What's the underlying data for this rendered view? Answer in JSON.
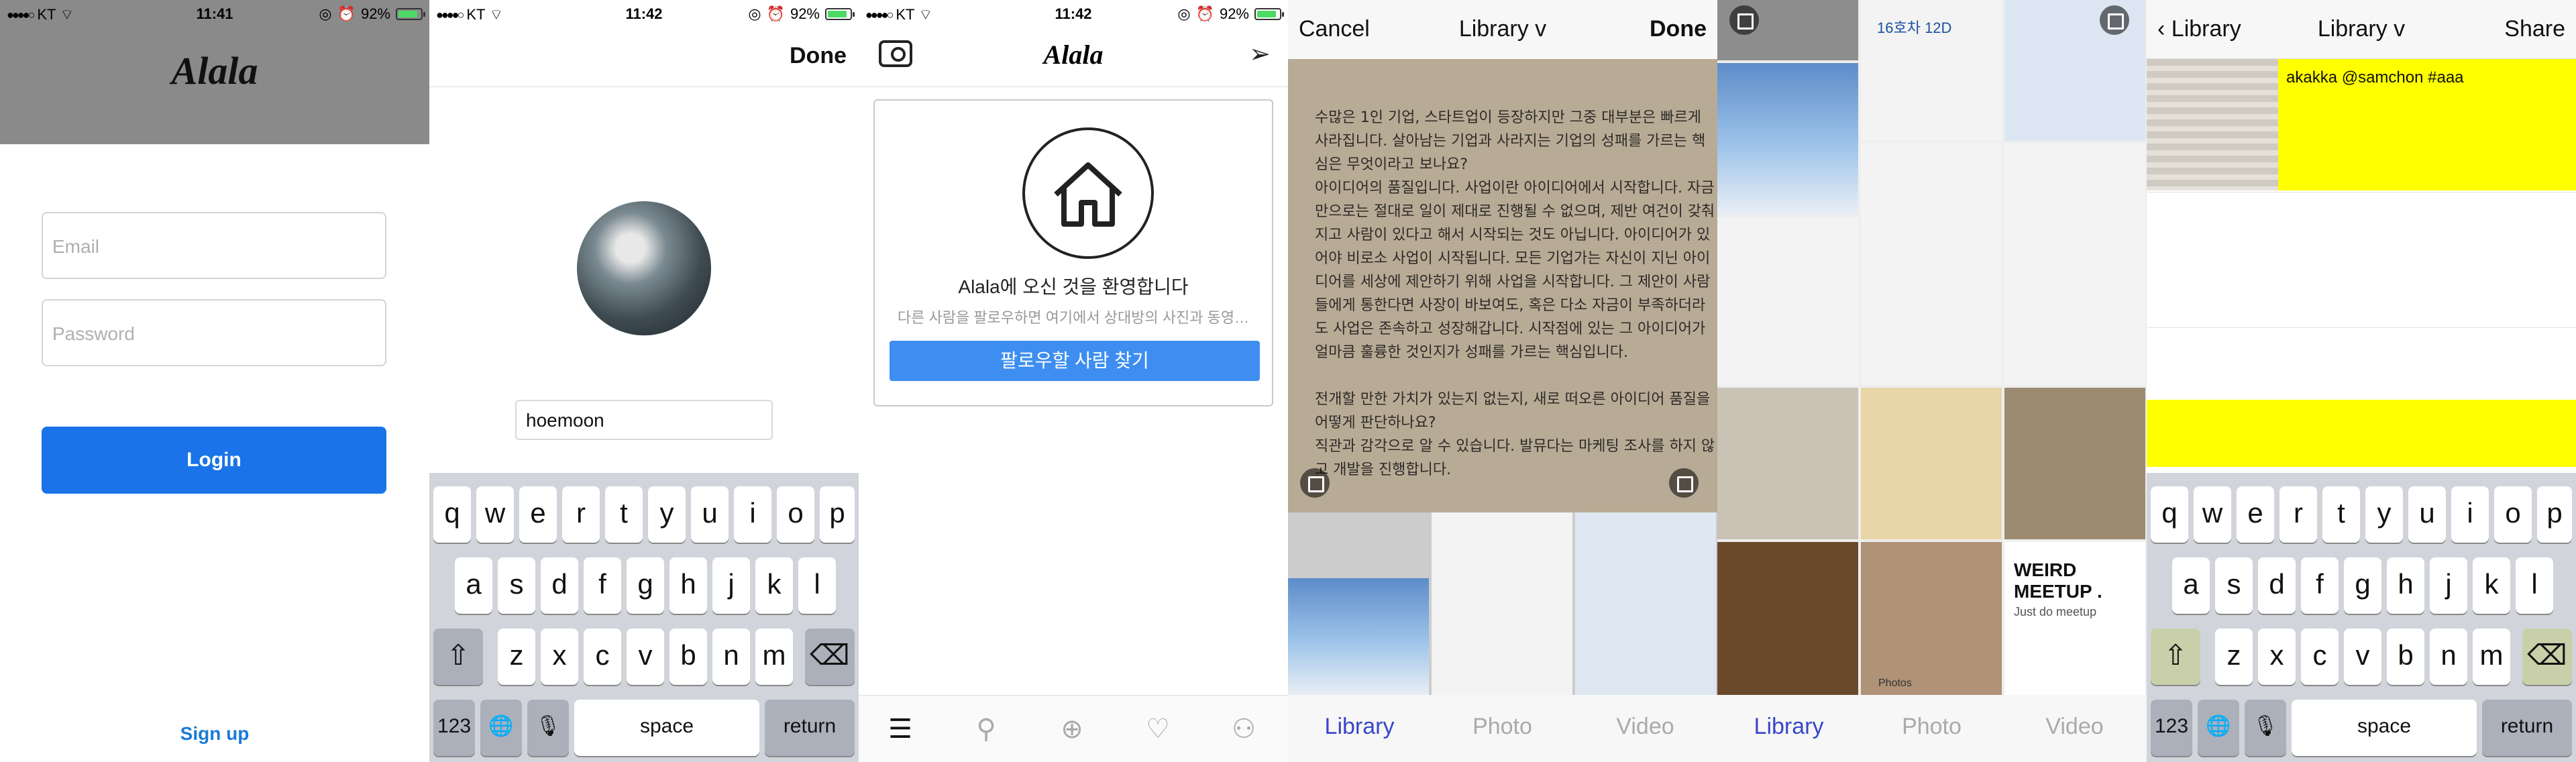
{
  "status": {
    "left_carrier": "KT",
    "battery": "92%",
    "times": [
      "11:41",
      "11:42",
      "11:42"
    ]
  },
  "login": {
    "logo": "Alala",
    "email_placeholder": "Email",
    "password_placeholder": "Password",
    "login_label": "Login",
    "signup_label": "Sign up"
  },
  "profile": {
    "done_label": "Done",
    "username_value": "hoemoon"
  },
  "keyboard": {
    "row1": [
      "q",
      "w",
      "e",
      "r",
      "t",
      "y",
      "u",
      "i",
      "o",
      "p"
    ],
    "row2": [
      "a",
      "s",
      "d",
      "f",
      "g",
      "h",
      "j",
      "k",
      "l"
    ],
    "row3": [
      "z",
      "x",
      "c",
      "v",
      "b",
      "n",
      "m"
    ],
    "num_label": "123",
    "space_label": "space",
    "return_label": "return"
  },
  "feed": {
    "logo": "Alala",
    "welcome": "Alala에 오신 것을 환영합니다",
    "sub": "다른 사람을 팔로우하면 여기에서 상대방의 사진과 동영…",
    "find_button": "팔로우할 사람 찾기"
  },
  "picker": {
    "cancel_label": "Cancel",
    "title": "Library v",
    "done_label": "Done",
    "doc_text": "수많은 1인 기업, 스타트업이 등장하지만 그중 대부분은 빠르게 사라집니다. 살아남는 기업과 사라지는 기업의 성패를 가르는 핵심은 무엇이라고 보나요?\n아이디어의 품질입니다. 사업이란 아이디어에서 시작합니다. 자금만으로는 절대로 일이 제대로 진행될 수 없으며, 제반 여건이 갖춰지고 사람이 있다고 해서 시작되는 것도 아닙니다. 아이디어가 있어야 비로소 사업이 시작됩니다. 모든 기업가는 자신이 지닌 아이디어를 세상에 제안하기 위해 사업을 시작합니다. 그 제안이 사람들에게 통한다면 사장이 바보여도, 혹은 다소 자금이 부족하더라도 사업은 존속하고 성장해갑니다. 시작점에 있는 그 아이디어가 얼마큼 훌륭한 것인지가 성패를 가르는 핵심입니다.\n\n전개할 만한 가치가 있는지 없는지, 새로 떠오른 아이디어 품질을 어떻게 판단하나요?\n직관과 감각으로 알 수 있습니다. 발뮤다는 마케팅 조사를 하지 않고 개발을 진행합니다.",
    "tabs": [
      "Library",
      "Photo",
      "Video"
    ]
  },
  "grid": {
    "tiles_text": [
      "16호차 12D",
      "WEIRD MEETUP .",
      "Just do meetup",
      "Photos"
    ],
    "tabs": [
      "Library",
      "Photo",
      "Video"
    ]
  },
  "share": {
    "back_label": "Library",
    "title": "Library v",
    "share_label": "Share",
    "caption": "akakka @samchon #aaa"
  },
  "colors": {
    "accent": "#1a73e8",
    "yellow": "#ffff00",
    "link": "#1a7ad6"
  }
}
